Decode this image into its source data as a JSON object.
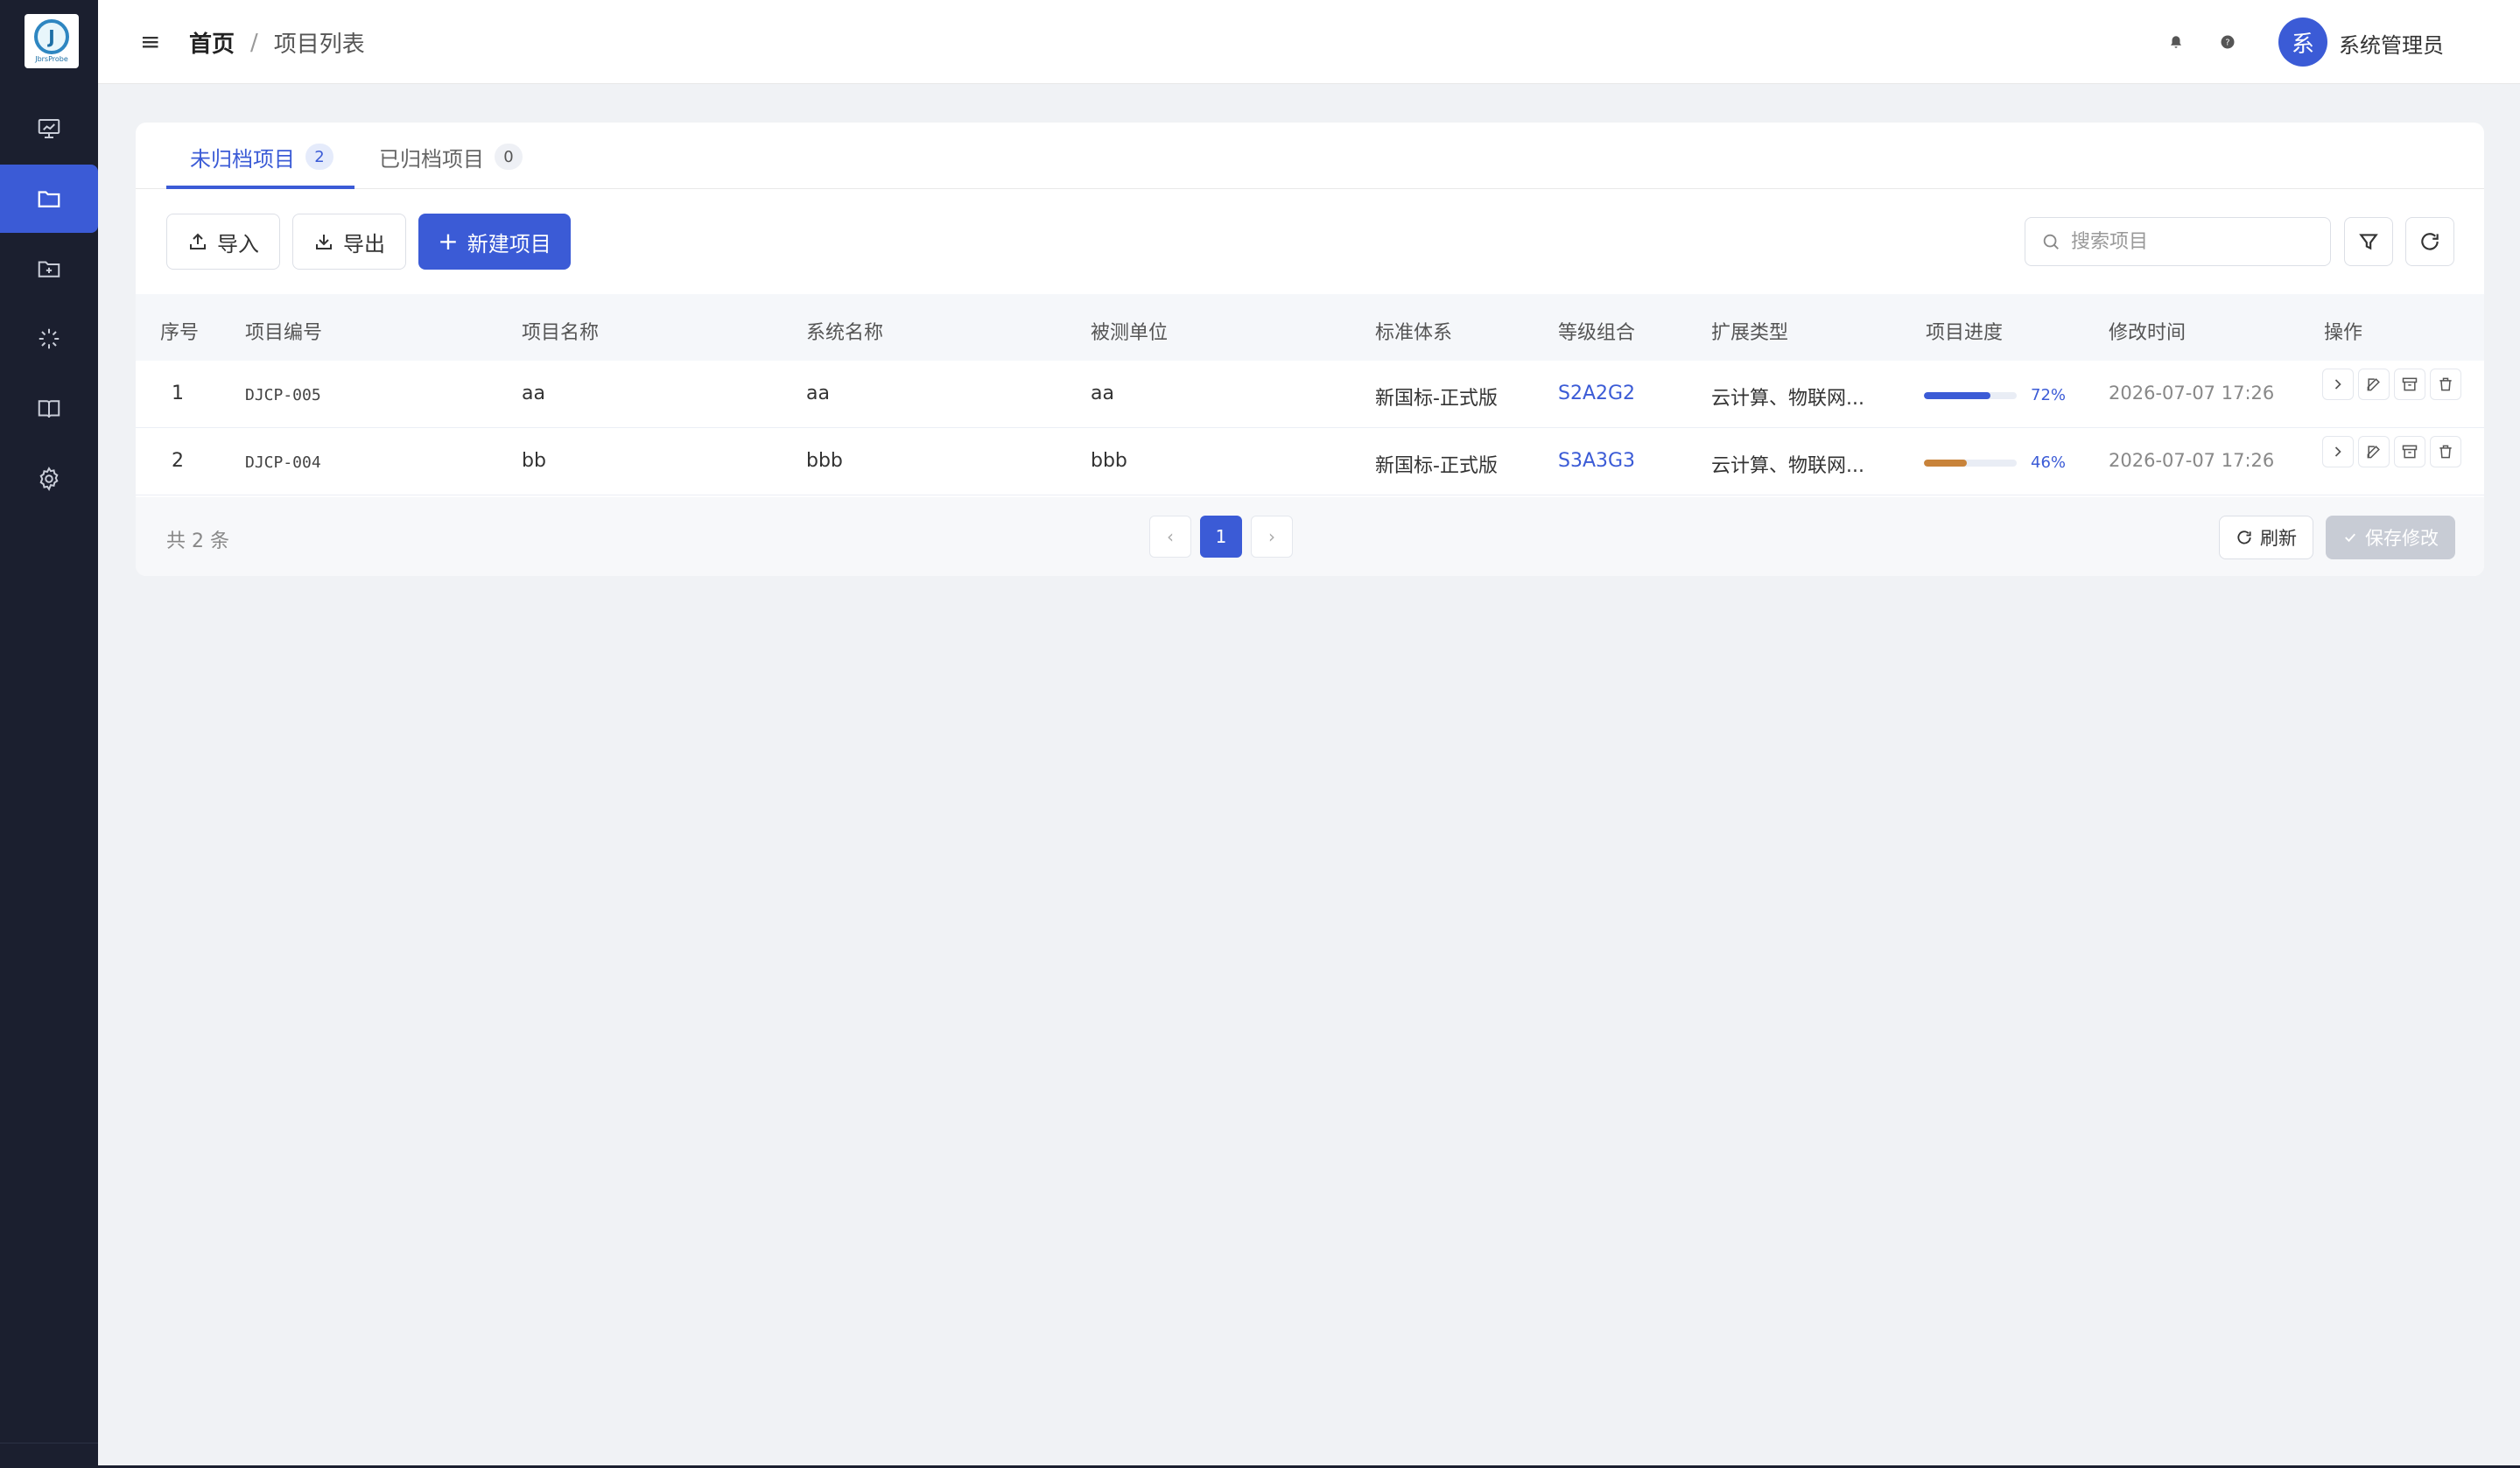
{
  "app": {
    "logo_text": "JbrsProbe",
    "logo_mark": "J"
  },
  "sidebar": {
    "items": [
      {
        "name": "dashboard",
        "icon": "presentation-chart-icon",
        "active": false
      },
      {
        "name": "projects",
        "icon": "folder-icon",
        "active": true
      },
      {
        "name": "new-project",
        "icon": "folder-plus-icon",
        "active": false
      },
      {
        "name": "loader",
        "icon": "loader-icon",
        "active": false
      },
      {
        "name": "knowledge",
        "icon": "book-icon",
        "active": false
      },
      {
        "name": "settings",
        "icon": "gear-icon",
        "active": false
      }
    ]
  },
  "header": {
    "breadcrumb": {
      "home": "首页",
      "separator": "/",
      "current": "项目列表"
    },
    "user": {
      "avatar_char": "系",
      "name": "系统管理员"
    },
    "icons": [
      "bell-icon",
      "help-icon"
    ]
  },
  "tabs": [
    {
      "label": "未归档项目",
      "count": "2",
      "active": true
    },
    {
      "label": "已归档项目",
      "count": "0",
      "active": false
    }
  ],
  "toolbar": {
    "import_label": "导入",
    "export_label": "导出",
    "new_label": "新建项目",
    "search_placeholder": "搜索项目"
  },
  "table": {
    "columns": [
      "序号",
      "项目编号",
      "项目名称",
      "系统名称",
      "被测单位",
      "标准体系",
      "等级组合",
      "扩展类型",
      "项目进度",
      "修改时间",
      "操作"
    ],
    "rows": [
      {
        "index": "1",
        "code": "DJCP-005",
        "name": "aa",
        "system": "aa",
        "unit": "aa",
        "standard": "新国标-正式版",
        "level": "S2A2G2",
        "ext": "云计算、物联网...",
        "progress": 72,
        "progress_label": "72%",
        "progress_color": "#3b5bd6",
        "modified": "2026-07-07 17:26"
      },
      {
        "index": "2",
        "code": "DJCP-004",
        "name": "bb",
        "system": "bbb",
        "unit": "bbb",
        "standard": "新国标-正式版",
        "level": "S3A3G3",
        "ext": "云计算、物联网...",
        "progress": 46,
        "progress_label": "46%",
        "progress_color": "#c8833a",
        "modified": "2026-07-07 17:26"
      }
    ]
  },
  "footer": {
    "total": "共 2 条",
    "prev": "‹",
    "page": "1",
    "next": "›",
    "refresh_label": "刷新",
    "save_label": "保存修改"
  },
  "colors": {
    "accent": "#3b5bd6",
    "sidebar_bg": "#1b1f2f",
    "page_bg": "#f0f2f5"
  }
}
